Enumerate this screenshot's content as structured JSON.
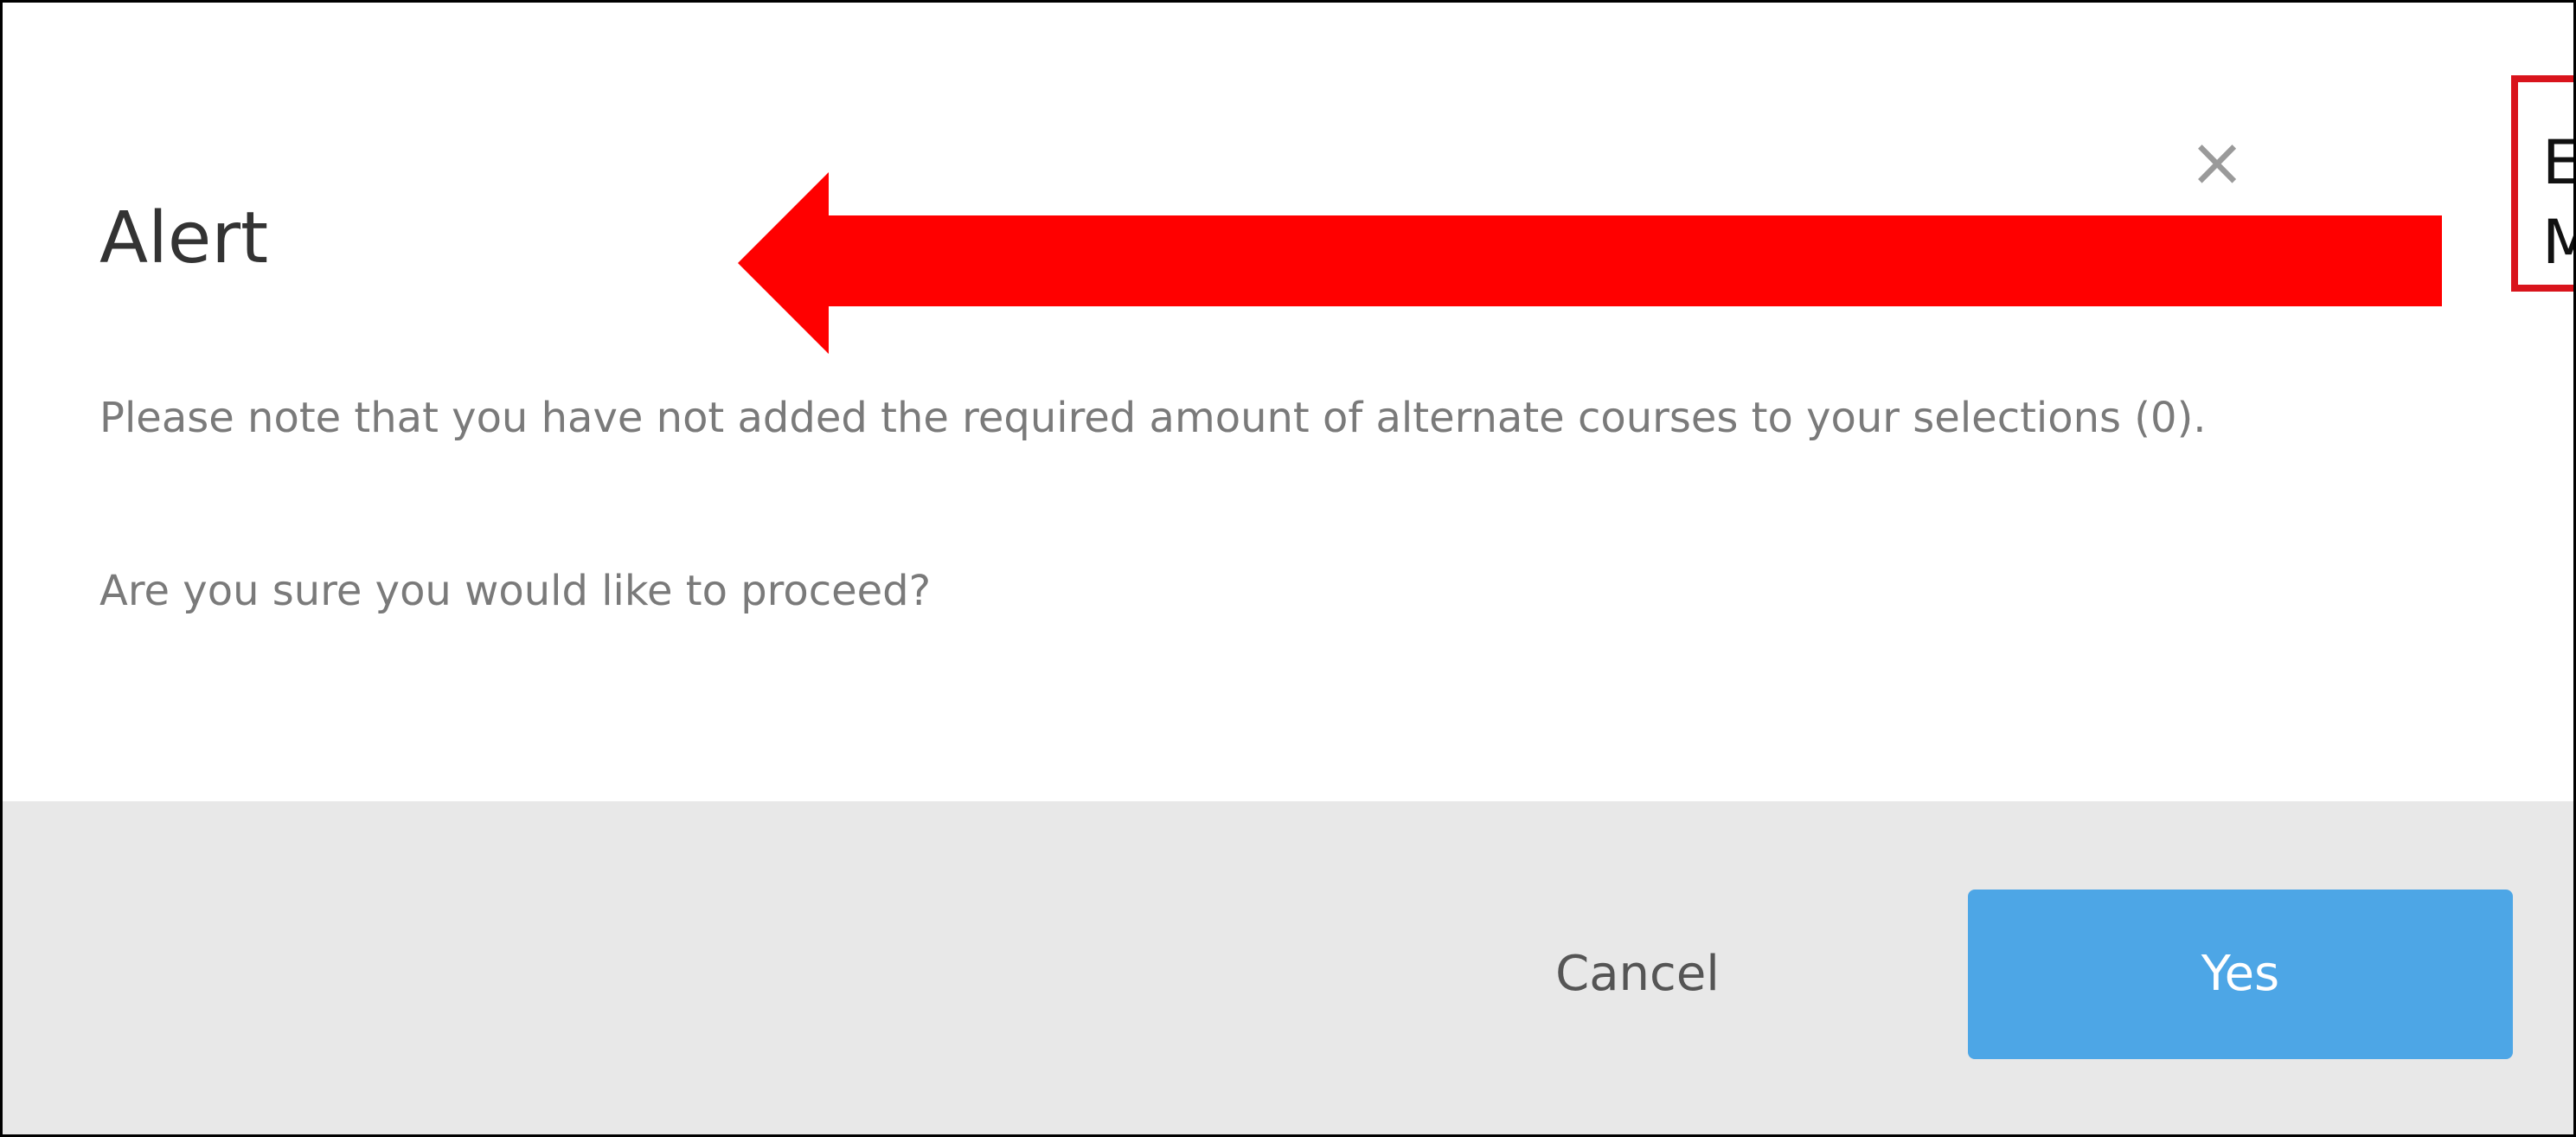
{
  "dialog": {
    "title": "Alert",
    "close_glyph": "×",
    "message_1": "Please note that you have not added the required amount of alternate courses to your selections (0).",
    "message_2": "Are you sure you would like to proceed?"
  },
  "footer": {
    "cancel_label": "Cancel",
    "yes_label": "Yes"
  },
  "annotation": {
    "arrow_color": "#ff0000",
    "box_color": "#d9141c",
    "box_line_1": "E",
    "box_line_2": "M"
  },
  "colors": {
    "yes_button": "#4da6e6",
    "footer_bg": "#e8e8e8",
    "message_text": "#7a7a7a"
  }
}
